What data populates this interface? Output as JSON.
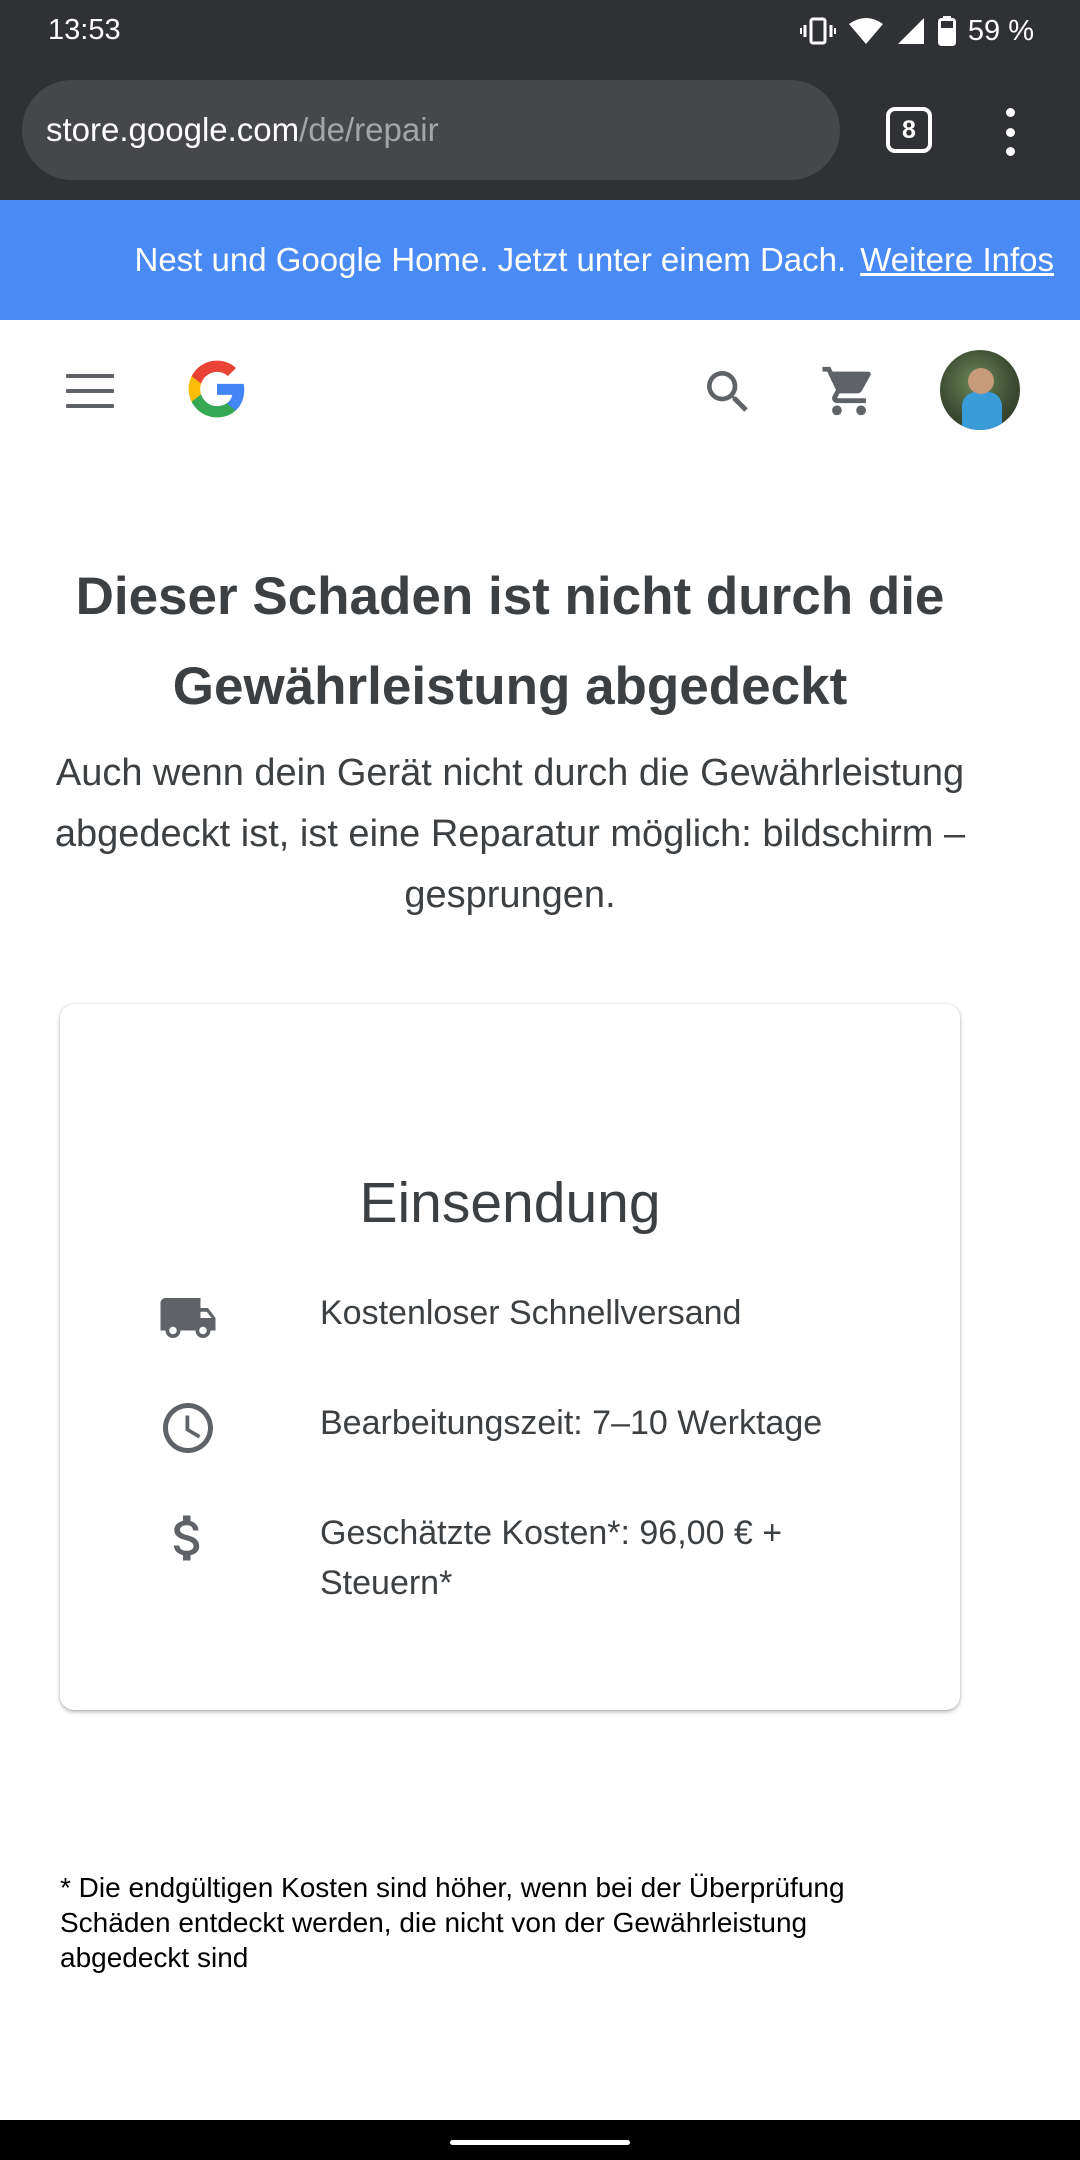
{
  "status_bar": {
    "time": "13:53",
    "battery": "59 %"
  },
  "browser": {
    "url_host": "store.google.com",
    "url_path": "/de/repair",
    "tab_count": "8"
  },
  "banner": {
    "text": "Nest und Google Home. Jetzt unter einem Dach.",
    "link": "Weitere Infos"
  },
  "header": {
    "icons": [
      "menu-icon",
      "google-logo",
      "search-icon",
      "cart-icon",
      "avatar"
    ]
  },
  "main": {
    "title": "Dieser Schaden ist nicht durch die Gewährleistung abgedeckt",
    "subtitle": "Auch wenn dein Gerät nicht durch die Gewährleistung abgedeckt ist, ist eine Reparatur möglich: bildschirm – gesprungen."
  },
  "card": {
    "title": "Einsendung",
    "rows": [
      {
        "icon": "truck-icon",
        "text": "Kostenloser Schnellversand"
      },
      {
        "icon": "clock-icon",
        "text": "Bearbeitungszeit: 7–10 Werktage"
      },
      {
        "icon": "dollar-icon",
        "text": "Geschätzte Kosten*: 96,00 € + Steuern*"
      }
    ]
  },
  "footnote": "* Die endgültigen Kosten sind höher, wenn bei der Überprüfung Schäden entdeckt werden, die nicht von der Gewährleistung abgedeckt sind",
  "colors": {
    "chrome": "#303134",
    "banner": "#4a8af4",
    "text": "#3c4043",
    "icon": "#5f6368"
  }
}
